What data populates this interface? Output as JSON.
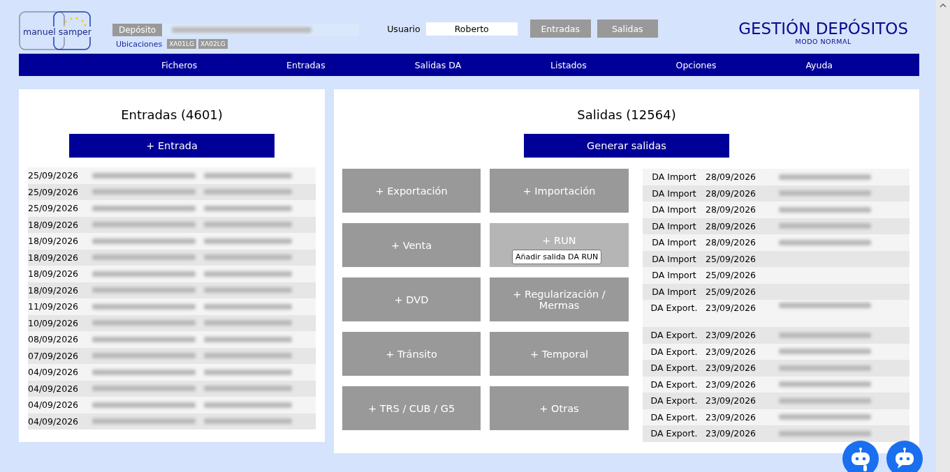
{
  "header": {
    "logo_text": "manuel samper",
    "deposit_label": "Depósito",
    "deposit_redacted": true,
    "locations_label": "Ubicaciones",
    "locations": [
      "XA01LG",
      "XA02LG"
    ],
    "user_label": "Usuario",
    "user_value": "Roberto",
    "shortcut_buttons": [
      "Entradas",
      "Salidas"
    ],
    "app_title": "GESTIÓN DEPÓSITOS",
    "mode": "MODO NORMAL"
  },
  "menu": [
    "Ficheros",
    "Entradas",
    "Salidas DA",
    "Listados",
    "Opciones",
    "Ayuda"
  ],
  "entries_panel": {
    "title": "Entradas (4601)",
    "button": "+ Entrada",
    "rows": [
      {
        "date": "25/09/2026",
        "redacted": true
      },
      {
        "date": "25/09/2026",
        "redacted": true
      },
      {
        "date": "25/09/2026",
        "redacted": true
      },
      {
        "date": "18/09/2026",
        "redacted": true
      },
      {
        "date": "18/09/2026",
        "redacted": true
      },
      {
        "date": "18/09/2026",
        "redacted": true
      },
      {
        "date": "18/09/2026",
        "redacted": true
      },
      {
        "date": "18/09/2026",
        "redacted": true
      },
      {
        "date": "11/09/2026",
        "redacted": true
      },
      {
        "date": "10/09/2026",
        "redacted": true
      },
      {
        "date": "08/09/2026",
        "redacted": true
      },
      {
        "date": "07/09/2026",
        "redacted": true
      },
      {
        "date": "04/09/2026",
        "redacted": true
      },
      {
        "date": "04/09/2026",
        "redacted": true
      },
      {
        "date": "04/09/2026",
        "redacted": true
      },
      {
        "date": "04/09/2026",
        "redacted": true
      }
    ]
  },
  "exits_panel": {
    "title": "Salidas (12564)",
    "button": "Generar salidas",
    "actions": [
      {
        "label": "+ Exportación",
        "hovered": false
      },
      {
        "label": "+ Venta",
        "hovered": false
      },
      {
        "label": "+ DVD",
        "hovered": false
      },
      {
        "label": "+ Tránsito",
        "hovered": false
      },
      {
        "label": "+ TRS / CUB / G5",
        "hovered": false
      },
      {
        "label": "+ Importación",
        "hovered": false
      },
      {
        "label": "+ RUN",
        "hovered": true,
        "tooltip": "Añadir salida DA RUN"
      },
      {
        "label": "+ Regularización / Mermas",
        "hovered": false
      },
      {
        "label": "+ Temporal",
        "hovered": false
      },
      {
        "label": "+ Otras",
        "hovered": false
      }
    ],
    "rows": [
      {
        "type": "DA Import",
        "date": "28/09/2026",
        "redacted": true
      },
      {
        "type": "DA Import",
        "date": "28/09/2026",
        "redacted": true
      },
      {
        "type": "DA Import",
        "date": "28/09/2026",
        "redacted": true
      },
      {
        "type": "DA Import",
        "date": "28/09/2026",
        "redacted": true
      },
      {
        "type": "DA Import",
        "date": "28/09/2026",
        "redacted": true
      },
      {
        "type": "DA Import",
        "date": "25/09/2026",
        "redacted": false
      },
      {
        "type": "DA Import",
        "date": "25/09/2026",
        "redacted": false
      },
      {
        "type": "DA Import",
        "date": "25/09/2026",
        "redacted": false
      },
      {
        "type": "DA Export.",
        "date": "23/09/2026",
        "redacted": true
      },
      {
        "type": "DA Export.",
        "date": "23/09/2026",
        "redacted": true
      },
      {
        "type": "DA Export.",
        "date": "23/09/2026",
        "redacted": true
      },
      {
        "type": "DA Export.",
        "date": "23/09/2026",
        "redacted": true
      },
      {
        "type": "DA Export.",
        "date": "23/09/2026",
        "redacted": true
      },
      {
        "type": "DA Export.",
        "date": "23/09/2026",
        "redacted": true
      },
      {
        "type": "DA Export.",
        "date": "23/09/2026",
        "redacted": true
      },
      {
        "type": "DA Export.",
        "date": "23/09/2026",
        "redacted": true
      }
    ]
  }
}
